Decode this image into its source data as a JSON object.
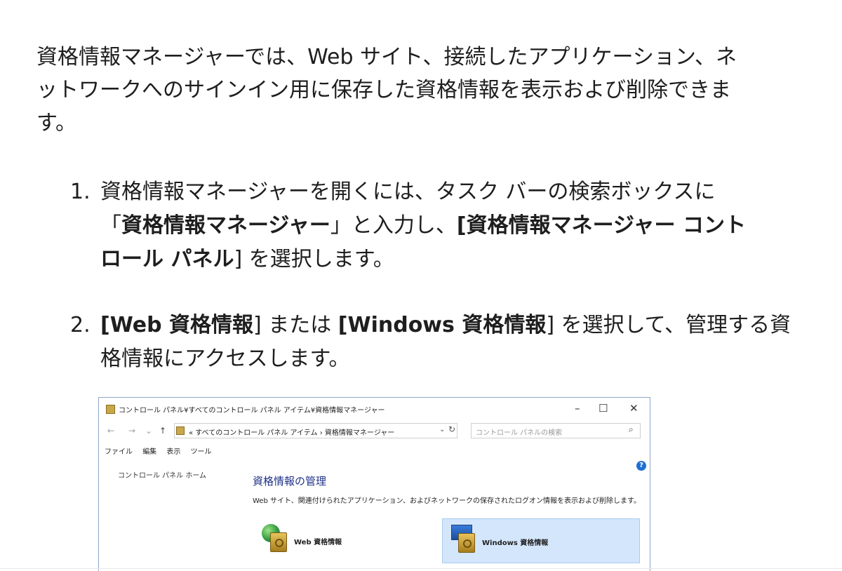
{
  "intro": {
    "line1": "資格情報マネージャーでは、Web サイト、接続したアプリケーション、ネ",
    "line2": "ットワークへのサインイン用に保存した資格情報を表示および削除できま",
    "line3": "す。"
  },
  "steps": [
    {
      "number": "1.",
      "t1": "資格情報マネージャーを開くには、タスク バーの検索ボックスに",
      "t2": "「",
      "b1": "資格情報マネージャー",
      "t3": "」と入力し、",
      "b2a": "[資格情報マネージャー コント",
      "b2b": "ロール パネル",
      "t4": "] を選択します。"
    },
    {
      "number": "2.",
      "b1": "[Web 資格情報",
      "t1": "] または ",
      "b2": "[Windows 資格情報",
      "t2": "] を選択して、管理する資",
      "t3": "格情報にアクセスします。"
    }
  ],
  "window": {
    "title": "コントロール パネル¥すべてのコントロール パネル アイテム¥資格情報マネージャー",
    "minimize": "–",
    "maximize": "☐",
    "close": "✕",
    "back": "←",
    "forward": "→",
    "recent": "⌄",
    "up": "↑",
    "address": "« すべてのコントロール パネル アイテム › 資格情報マネージャー",
    "address_dropdown": "⌄",
    "refresh": "↻",
    "search_placeholder": "コントロール パネルの検索",
    "search_icon_glyph": "⌕",
    "menu": [
      "ファイル",
      "編集",
      "表示",
      "ツール"
    ],
    "sidebar_link": "コントロール パネル ホーム",
    "help": "?",
    "heading": "資格情報の管理",
    "description": "Web サイト、関連付けられたアプリケーション、およびネットワークの保存されたログオン情報を表示および削除します。",
    "web_credentials": "Web 資格情報",
    "windows_credentials": "Windows 資格情報"
  },
  "colors": {
    "heading_blue": "#1e3287",
    "selected_tile": "#d3e6fb"
  }
}
